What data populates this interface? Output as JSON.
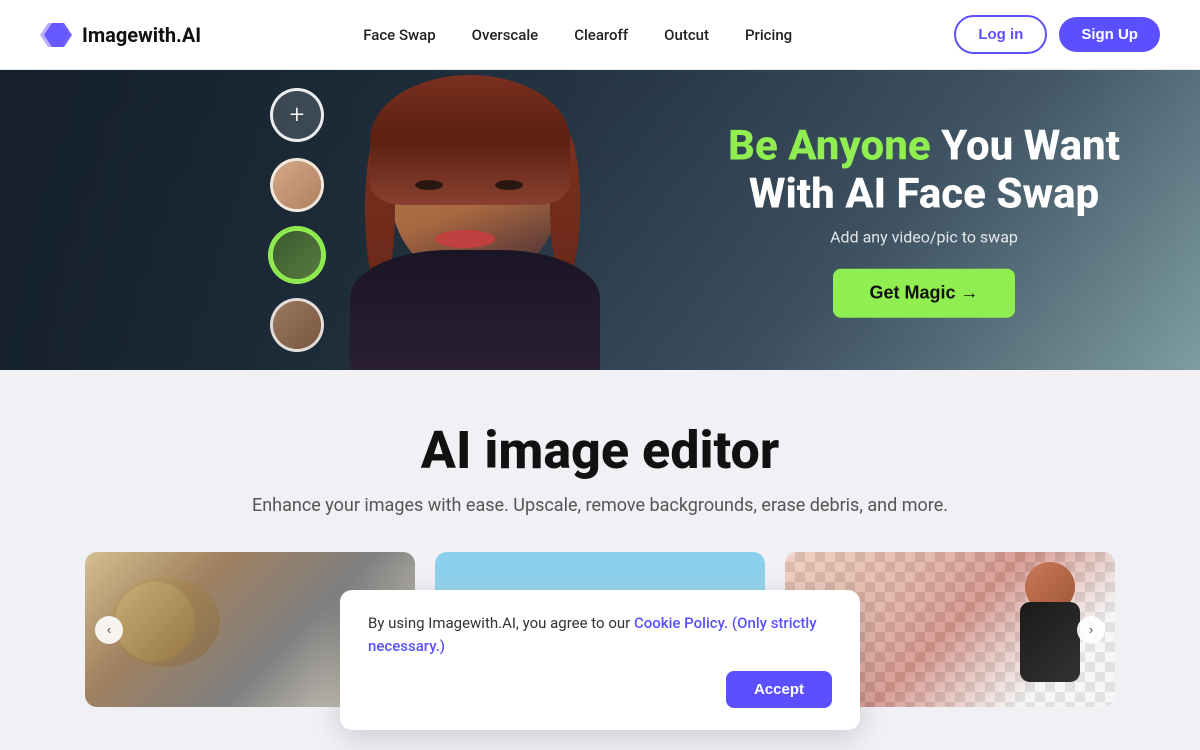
{
  "brand": {
    "name": "Imagewith.AI"
  },
  "nav": {
    "links": [
      {
        "id": "face-swap",
        "label": "Face Swap"
      },
      {
        "id": "overscale",
        "label": "Overscale"
      },
      {
        "id": "clearoff",
        "label": "Clearoff"
      },
      {
        "id": "outcut",
        "label": "Outcut"
      },
      {
        "id": "pricing",
        "label": "Pricing"
      }
    ],
    "login_label": "Log in",
    "signup_label": "Sign Up"
  },
  "hero": {
    "headline_highlight": "Be Anyone",
    "headline_rest": " You Want",
    "headline_line2": "With AI Face Swap",
    "subtext": "Add any video/pic to swap",
    "cta_label": "Get Magic →"
  },
  "main": {
    "title": "AI image editor",
    "subtitle": "Enhance your images with ease. Upscale, remove backgrounds, erase debris, and more."
  },
  "cookie": {
    "text": "By using Imagewith.AI, you agree to our ",
    "link_text": "Cookie Policy. (Only strictly necessary.)",
    "accept_label": "Accept"
  }
}
